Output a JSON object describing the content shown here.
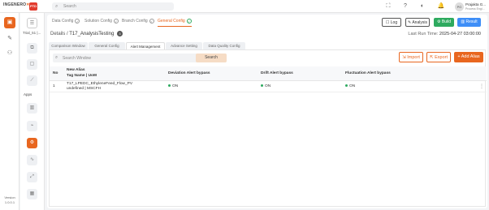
{
  "brand": {
    "name": "INGENERO",
    "badge": "PTD"
  },
  "search": {
    "placeholder": "Search"
  },
  "topbar_icons": [
    "expand-icon",
    "help-icon",
    "theme-icon",
    "notification-icon"
  ],
  "user": {
    "initials": "PG",
    "name": "Prajakta G...",
    "role": "Process Engi..."
  },
  "sidebar": {
    "version_label": "Version",
    "version": "1.0.0.1"
  },
  "panel": {
    "title": "Trial_51 |...",
    "apps_label": "Apps"
  },
  "steps": [
    {
      "label": "Data Config"
    },
    {
      "label": "Solution Config"
    },
    {
      "label": "Branch Config"
    },
    {
      "label": "General Config"
    }
  ],
  "header_buttons": {
    "log": "Log",
    "analysis": "Analysis",
    "build": "Build",
    "result": "Result"
  },
  "breadcrumb": {
    "root": "Details",
    "sep": " / ",
    "current": "T17_AnalysisTesting",
    "count": "3"
  },
  "run_time": {
    "label": "Last Run Time:",
    "value": "2025-04-27 03:00:00"
  },
  "tabs": [
    "Comparison Window",
    "General Config",
    "Alert Management",
    "Advance Setting",
    "Data Quality Config"
  ],
  "active_tab": "Alert Management",
  "toolbar": {
    "search_placeholder": "Search Window",
    "search_button": "Search",
    "import": "Import",
    "export": "Export",
    "add": "Add Alias"
  },
  "table": {
    "headers": {
      "no": "No",
      "alias": "New Alias",
      "tag": "Tag Name | UoM",
      "deviation": "Deviation Alert bypass",
      "drift": "Drift Alert bypass",
      "fluctuation": "Fluctuation Alert bypass"
    },
    "rows": [
      {
        "no": "1",
        "tag": "T17_LPEDC_EthyleneFeed_Flow_PV",
        "uom": "undefined | MSCFH",
        "deviation": "ON",
        "drift": "ON",
        "fluctuation": "ON"
      }
    ]
  },
  "colors": {
    "accent": "#e8661f",
    "green": "#2eaa5f",
    "blue": "#3e8ef7"
  }
}
